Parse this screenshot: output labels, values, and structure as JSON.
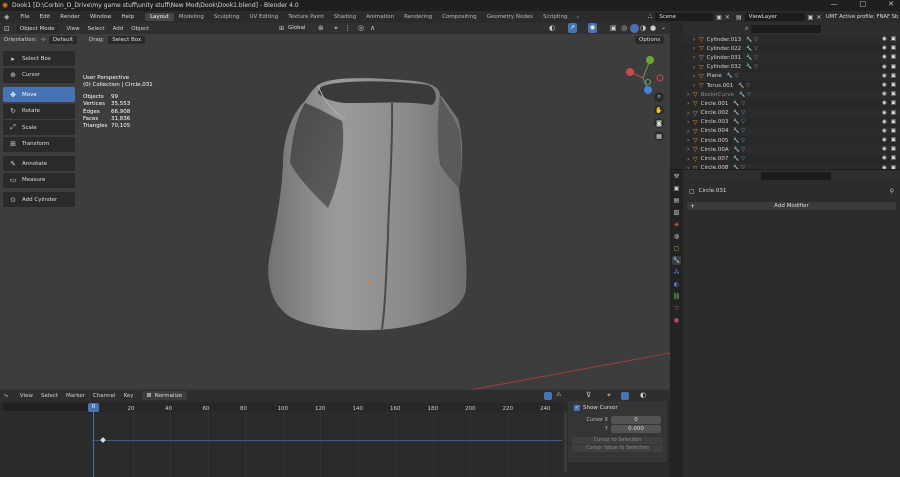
{
  "window": {
    "title": "Dook1 [D:\\Corbin_D_Drive\\my game stuff\\unity stuff\\New Mod\\Dook\\Dook1.blend] - Blender 4.0",
    "controls": [
      "—",
      "□",
      "✕"
    ]
  },
  "topbar": {
    "menus": [
      "File",
      "Edit",
      "Render",
      "Window",
      "Help"
    ],
    "workspaces": [
      "Layout",
      "Modeling",
      "Sculpting",
      "UV Editing",
      "Texture Paint",
      "Shading",
      "Animation",
      "Rendering",
      "Compositing",
      "Geometry Nodes",
      "Scripting"
    ],
    "active_workspace": "Layout",
    "scene": "Scene",
    "view_layer": "ViewLayer",
    "status": "UMT Active profile: FNAF Sb"
  },
  "viewport": {
    "mode": "Object Mode",
    "menus": [
      "View",
      "Select",
      "Add",
      "Object"
    ],
    "orientation_label": "Orientation:",
    "orientation": "Default",
    "drag_label": "Drag:",
    "drag": "Select Box",
    "transform": "Global",
    "options": "Options",
    "overlay_title": "User Perspective",
    "overlay_collection": "(0) Collection | Circle.031",
    "stats": [
      {
        "k": "Objects",
        "v": "99"
      },
      {
        "k": "Vertices",
        "v": "35,553"
      },
      {
        "k": "Edges",
        "v": "66,908"
      },
      {
        "k": "Faces",
        "v": "31,836"
      },
      {
        "k": "Triangles",
        "v": "70,105"
      }
    ],
    "gizmo_axes": [
      "Y",
      "X",
      "Z"
    ]
  },
  "toolbar": [
    {
      "label": "Select Box",
      "icon": "select-box-icon",
      "glyph": "▸"
    },
    {
      "label": "Cursor",
      "icon": "cursor-icon",
      "glyph": "⊕"
    },
    {
      "label": "Move",
      "icon": "move-icon",
      "glyph": "✥",
      "active": true
    },
    {
      "label": "Rotate",
      "icon": "rotate-icon",
      "glyph": "↻"
    },
    {
      "label": "Scale",
      "icon": "scale-icon",
      "glyph": "⤢"
    },
    {
      "label": "Transform",
      "icon": "transform-icon",
      "glyph": "⊞"
    },
    {
      "label": "Annotate",
      "icon": "annotate-icon",
      "glyph": "✎"
    },
    {
      "label": "Measure",
      "icon": "measure-icon",
      "glyph": "▭"
    },
    {
      "label": "Add Cylinder",
      "icon": "add-cylinder-icon",
      "glyph": "⊙"
    }
  ],
  "outliner": {
    "search_placeholder": "",
    "rows": [
      {
        "name": "Cylinder.013",
        "type": "mesh"
      },
      {
        "name": "Cylinder.022",
        "type": "mesh"
      },
      {
        "name": "Cylinder.031",
        "type": "mesh"
      },
      {
        "name": "Cylinder.032",
        "type": "mesh"
      },
      {
        "name": "Plane",
        "type": "mesh"
      },
      {
        "name": "Torus.001",
        "type": "mesh"
      },
      {
        "name": "BezierCurve",
        "type": "curve"
      },
      {
        "name": "Circle.001",
        "type": "mesh"
      },
      {
        "name": "Circle.002",
        "type": "mesh"
      },
      {
        "name": "Circle.003",
        "type": "mesh"
      },
      {
        "name": "Circle.004",
        "type": "mesh"
      },
      {
        "name": "Circle.005",
        "type": "mesh"
      },
      {
        "name": "Circle.00A",
        "type": "mesh"
      },
      {
        "name": "Circle.007",
        "type": "mesh"
      },
      {
        "name": "Circle.008",
        "type": "mesh"
      }
    ]
  },
  "properties": {
    "object_name": "Circle.031",
    "add_modifier": "Add Modifier",
    "tab_colors": [
      "#c9c9c9",
      "#c9c9c9",
      "#c9c9c9",
      "#c9c9c9",
      "#d85a3a",
      "#c9c9c9",
      "#e0a040",
      "#5a8fe0",
      "#5a8fe0",
      "#5a8fe0",
      "#60c060",
      "#e0504a",
      "#c84060"
    ]
  },
  "timeline": {
    "menus": [
      "View",
      "Select",
      "Marker",
      "Channel",
      "Key"
    ],
    "normalize": "Normalize",
    "ticks": [
      "0",
      "20",
      "40",
      "60",
      "80",
      "100",
      "120",
      "140",
      "160",
      "180",
      "200",
      "220",
      "240"
    ],
    "current_frame": "0",
    "show_cursor": "Show Cursor",
    "cursor_x_label": "Cursor X",
    "cursor_x": "0",
    "cursor_y_label": "Y",
    "cursor_y": "0.000",
    "cursor_to_selection": "Cursor to Selection",
    "cursor_value_to_selection": "Cursor Value to Selection"
  }
}
